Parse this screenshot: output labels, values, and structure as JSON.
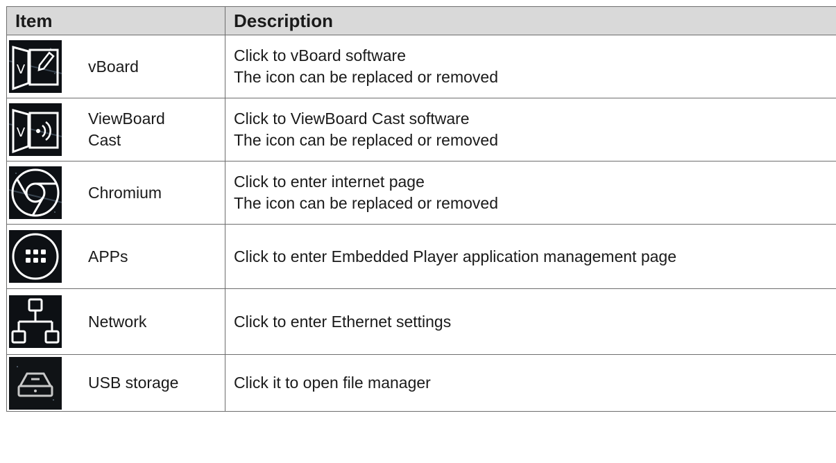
{
  "header": {
    "item": "Item",
    "description": "Description"
  },
  "rows": [
    {
      "icon": "vboard-icon",
      "item": "vBoard",
      "description": "Click to vBoard software\nThe icon can be replaced or removed"
    },
    {
      "icon": "viewboard-cast-icon",
      "item": "ViewBoard\nCast",
      "description": "Click to ViewBoard Cast software\nThe icon can be replaced or removed"
    },
    {
      "icon": "chromium-icon",
      "item": "Chromium",
      "description": "Click to enter internet page\nThe icon can be replaced or removed"
    },
    {
      "icon": "apps-icon",
      "item": "APPs",
      "description": "Click to enter Embedded Player application management page"
    },
    {
      "icon": "network-icon",
      "item": "Network",
      "description": "Click to enter Ethernet settings"
    },
    {
      "icon": "usb-storage-icon",
      "item": "USB storage",
      "description": "Click it to open file manager"
    }
  ]
}
